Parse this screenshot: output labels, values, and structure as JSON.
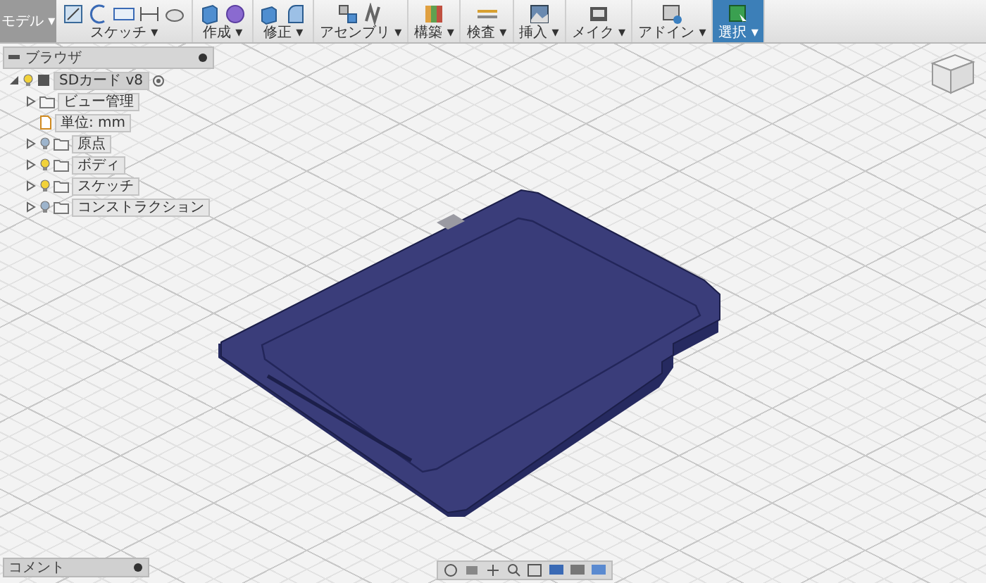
{
  "toolbar": {
    "workspace": "モデル ▾",
    "groups": [
      {
        "kind": "sketch",
        "label": "スケッチ ▾",
        "selected": false
      },
      {
        "kind": "create",
        "label": "作成 ▾",
        "selected": false
      },
      {
        "kind": "modify",
        "label": "修正 ▾",
        "selected": false
      },
      {
        "kind": "assemble",
        "label": "アセンブリ ▾",
        "selected": false
      },
      {
        "kind": "construct",
        "label": "構築 ▾",
        "selected": false
      },
      {
        "kind": "inspect",
        "label": "検査 ▾",
        "selected": false
      },
      {
        "kind": "insert",
        "label": "挿入 ▾",
        "selected": false
      },
      {
        "kind": "make",
        "label": "メイク ▾",
        "selected": false
      },
      {
        "kind": "addins",
        "label": "アドイン ▾",
        "selected": false
      },
      {
        "kind": "select",
        "label": "選択 ▾",
        "selected": true
      }
    ]
  },
  "browser": {
    "title": "ブラウザ",
    "root": {
      "label": "SDカード v8",
      "expanded": true,
      "visible": true,
      "children": [
        {
          "kind": "folder",
          "label": "ビュー管理",
          "expanded": false
        },
        {
          "kind": "units",
          "label": "単位: mm"
        },
        {
          "kind": "folder",
          "label": "原点",
          "expanded": false,
          "visible": false
        },
        {
          "kind": "folder",
          "label": "ボディ",
          "expanded": false,
          "visible": true
        },
        {
          "kind": "folder",
          "label": "スケッチ",
          "expanded": false,
          "visible": true
        },
        {
          "kind": "folder",
          "label": "コンストラクション",
          "expanded": false,
          "visible": false
        }
      ]
    }
  },
  "comments": {
    "label": "コメント"
  }
}
